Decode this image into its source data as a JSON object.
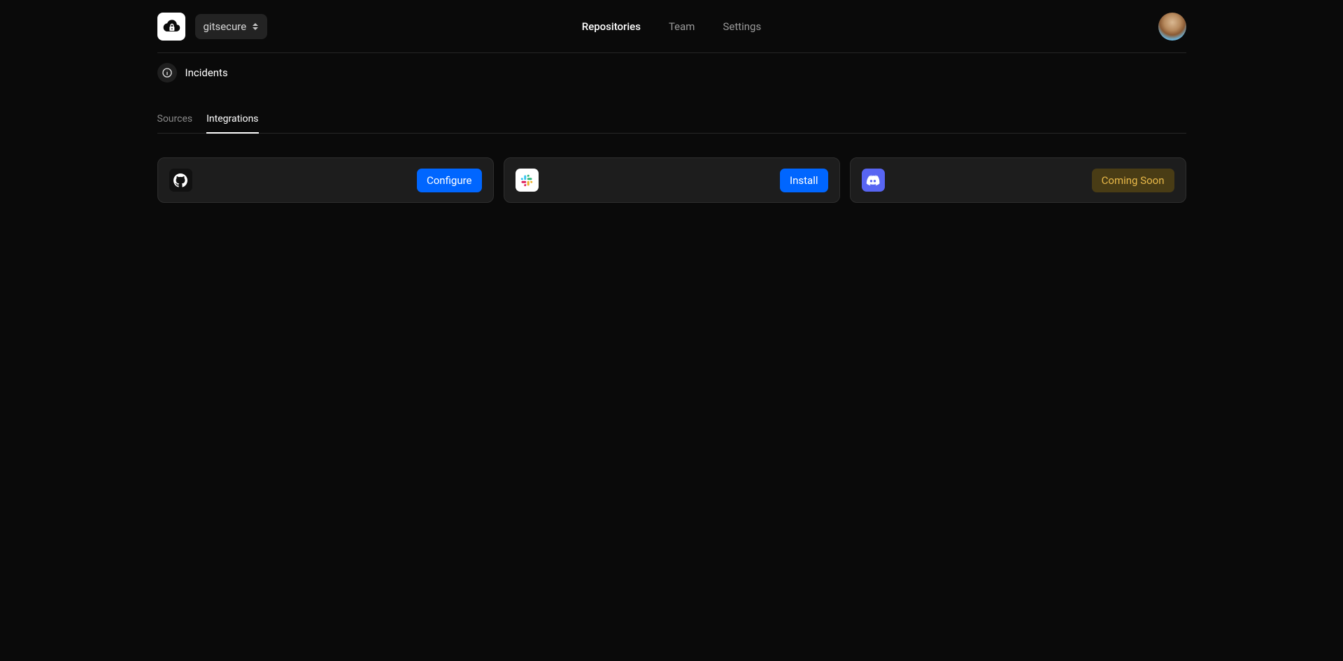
{
  "header": {
    "project_name": "gitsecure",
    "nav": {
      "repositories": "Repositories",
      "team": "Team",
      "settings": "Settings"
    }
  },
  "subheader": {
    "title": "Incidents"
  },
  "tabs": {
    "sources": "Sources",
    "integrations": "Integrations"
  },
  "integrations": {
    "github": {
      "action": "Configure"
    },
    "slack": {
      "action": "Install"
    },
    "discord": {
      "action": "Coming Soon"
    }
  }
}
